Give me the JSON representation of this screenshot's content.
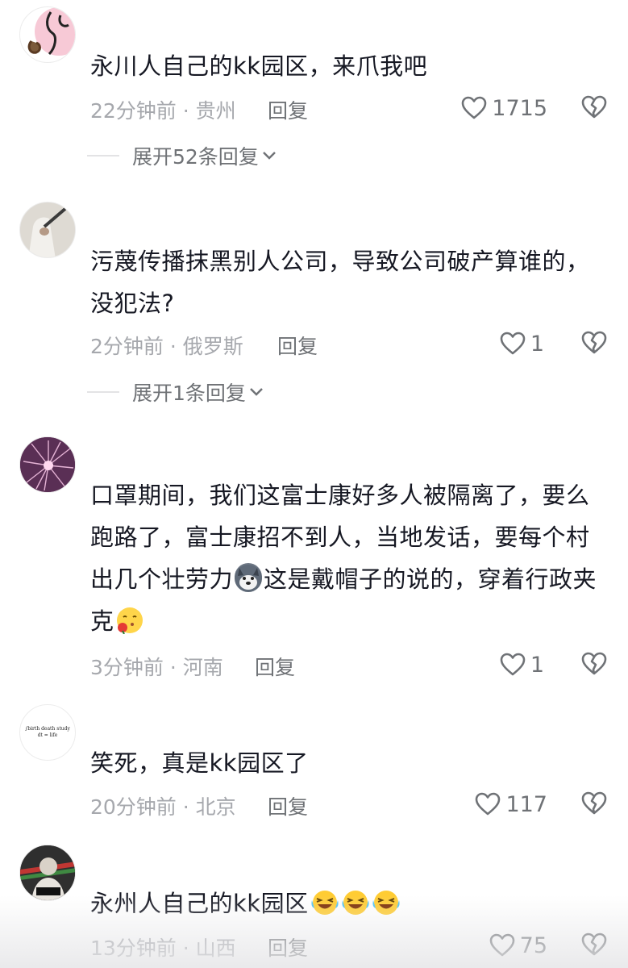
{
  "comments": [
    {
      "text": "永川人自己的kk园区，来爪我吧",
      "time": "22分钟前 · 贵州",
      "reply": "回复",
      "likes": "1715",
      "expand": "展开52条回复"
    },
    {
      "text": "污蔑传播抹黑别人公司，导致公司破产算谁的，没犯法?",
      "time": "2分钟前 · 俄罗斯",
      "reply": "回复",
      "likes": "1",
      "expand": "展开1条回复"
    },
    {
      "text_a": "口罩期间，我们这富士康好多人被隔离了，要么跑路了，富士康招不到人，当地发话，要每个村出几个壮劳力",
      "text_b": "这是戴帽子的说的，穿着行政夹克",
      "time": "3分钟前 · 河南",
      "reply": "回复",
      "likes": "1"
    },
    {
      "text": "笑死，真是kk园区了",
      "time": "20分钟前 · 北京",
      "reply": "回复",
      "likes": "117",
      "avatar_text": "∫birth death study dt = life"
    },
    {
      "text": "永州人自己的kk园区",
      "time": "13分钟前 · 山西",
      "reply": "回复",
      "likes": "75"
    }
  ],
  "icons": {
    "like": "heart-outline-icon",
    "dislike": "broken-heart-icon",
    "expand": "chevron-down-icon",
    "emoji_1": "husky-dog-emoji",
    "emoji_2": "kissing-rose-emoji",
    "emoji_3": "laughing-tears-emoji"
  }
}
